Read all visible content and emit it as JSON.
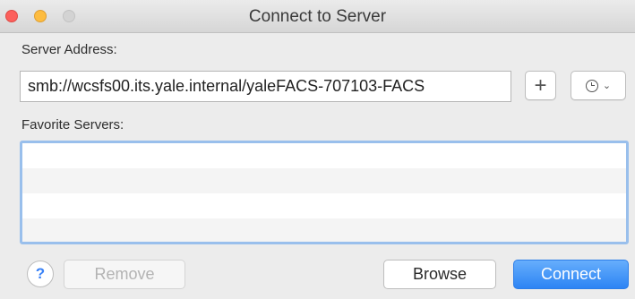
{
  "window": {
    "title": "Connect to Server"
  },
  "server_address": {
    "label": "Server Address:",
    "value": "smb://wcsfs00.its.yale.internal/yaleFACS-707103-FACS",
    "add_label": "+"
  },
  "favorites": {
    "label": "Favorite Servers:",
    "items": []
  },
  "buttons": {
    "help_label": "?",
    "remove_label": "Remove",
    "browse_label": "Browse",
    "connect_label": "Connect"
  },
  "colors": {
    "accent": "#2d84f4",
    "focus_ring": "#99bfec",
    "close": "#fc605c",
    "minimize": "#fdbc40"
  },
  "icons": {
    "recent": "clock-icon",
    "dropdown": "chevron-down-icon"
  }
}
